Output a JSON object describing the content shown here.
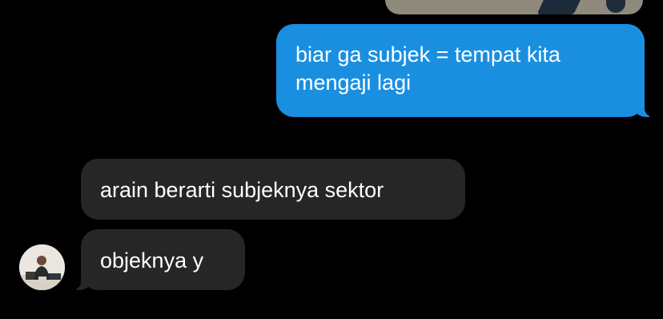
{
  "conversation": {
    "top_image": {
      "icon": "photo-attachment"
    },
    "outgoing": [
      {
        "lines": [
          "biar ga subjek = tempat kita",
          "mengaji lagi"
        ],
        "color": "#1a8fe0"
      }
    ],
    "incoming": [
      {
        "text": "arain berarti subjeknya sektor",
        "color": "#262626"
      },
      {
        "text": "objeknya y",
        "color": "#262626"
      }
    ],
    "sender": {
      "avatar_icon": "person-photo"
    }
  }
}
